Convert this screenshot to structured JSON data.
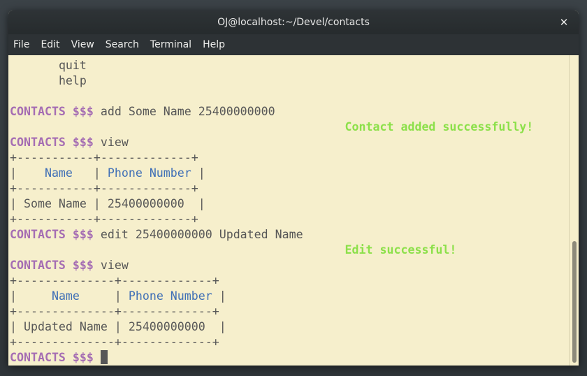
{
  "window": {
    "title": "OJ@localhost:~/Devel/contacts",
    "close_glyph": "✕"
  },
  "menu": [
    "File",
    "Edit",
    "View",
    "Search",
    "Terminal",
    "Help"
  ],
  "terminal": {
    "lines": [
      {
        "indent": "       ",
        "text": "quit"
      },
      {
        "indent": "       ",
        "text": "help"
      },
      {
        "prompt": "CONTACTS $$$",
        "cmd": " add Some Name 25400000000"
      },
      {
        "message_pad": "                                                ",
        "message": "Contact added successfully!"
      },
      {
        "prompt": "CONTACTS $$$",
        "cmd": " view"
      },
      {
        "text": "+-----------+-------------+"
      },
      {
        "pre": "|    ",
        "h1": "Name",
        "mid": "   | ",
        "h2": "Phone Number",
        "post": " |"
      },
      {
        "text": "+-----------+-------------+"
      },
      {
        "text": "| Some Name | 25400000000  |"
      },
      {
        "text": "+-----------+-------------+"
      },
      {
        "prompt": "CONTACTS $$$",
        "cmd": " edit 25400000000 Updated Name"
      },
      {
        "message_pad": "                                                ",
        "message": "Edit successful!"
      },
      {
        "prompt": "CONTACTS $$$",
        "cmd": " view"
      },
      {
        "text": "+--------------+-------------+"
      },
      {
        "pre": "|     ",
        "h1": "Name",
        "mid": "     | ",
        "h2": "Phone Number",
        "post": " |"
      },
      {
        "text": "+--------------+-------------+"
      },
      {
        "text": "| Updated Name | 25400000000  |"
      },
      {
        "text": "+--------------+-------------+"
      },
      {
        "prompt": "CONTACTS $$$",
        "cmd": " "
      }
    ]
  },
  "colors": {
    "terminal_bg": "#f6efcc",
    "terminal_fg": "#575757",
    "prompt": "#a56db3",
    "success": "#8ce04a",
    "header": "#3f6fb6"
  }
}
